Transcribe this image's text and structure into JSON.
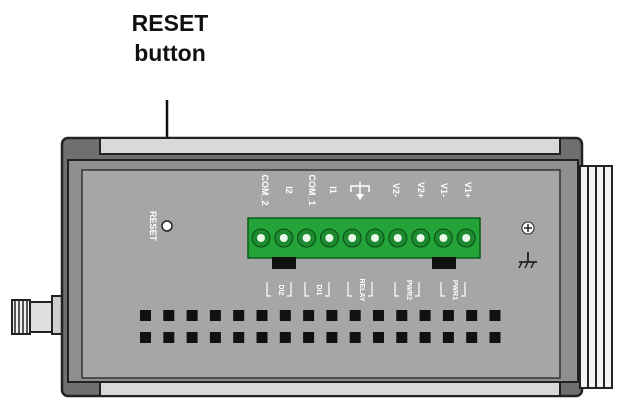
{
  "callout": {
    "line1": "RESET",
    "line2": "button"
  },
  "panel": {
    "reset_label": "RESET"
  },
  "terminal": {
    "labels": [
      "COM_2",
      "I2",
      "COM_1",
      "I1",
      "",
      "V2-",
      "V2+",
      "V1-",
      "V1+"
    ],
    "pin_count": 10
  },
  "leds": [
    "DI2",
    "DI1",
    "RELAY",
    "PWR2",
    "PWR1"
  ],
  "vent": {
    "columns": 16,
    "rows": 2
  },
  "colors": {
    "panel": "#a6a6a6",
    "frame": "#8f8f8f",
    "terminal": "#23a338",
    "pin": "#e9fbe9",
    "callout_text": "#111111"
  },
  "icons": [
    "ground-symbol-icon",
    "screw-icon",
    "antenna-connector-icon",
    "reset-hole-icon"
  ]
}
